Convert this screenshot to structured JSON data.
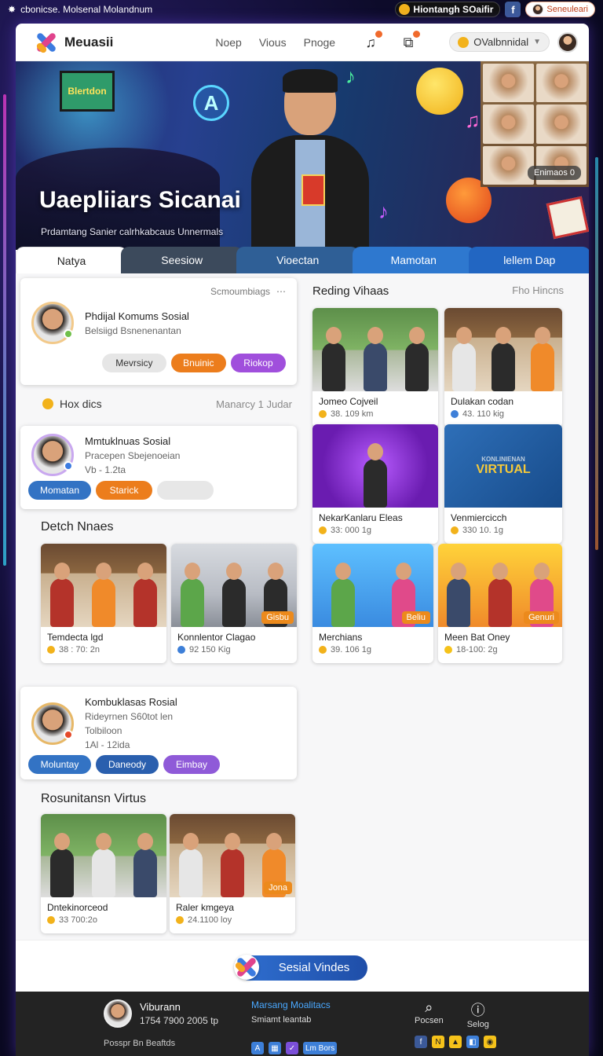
{
  "topbar": {
    "brand_text": "cbonicse. Molsenal Molandnum",
    "coin_pill": "Hiontangh SOaifir",
    "fb_letter": "f",
    "right_pill": "Seneuleari"
  },
  "nav": {
    "logo_text": "Meuasii",
    "links": [
      "Noep",
      "Vious",
      "Pnoge"
    ],
    "account_label": "OValbnnidal",
    "icons": [
      "music-icon",
      "box-icon"
    ]
  },
  "hero": {
    "screen_text": "Blertdon",
    "badge": "Enimaos 0",
    "title": "Uaepliiars Sicanai",
    "subtitle": "Prdamtang Sanier calrhkabcaus Unnermals"
  },
  "tabs": [
    "Natya",
    "Seesiow",
    "Vioectan",
    "Mamotan",
    "lellem Dap"
  ],
  "left": {
    "card1": {
      "header": "Scmoumbiags",
      "name": "Phdijal Komums Sosial",
      "line1": "Belsiigd Bsnenenantan",
      "buttons": [
        "Mevrsicy",
        "Bnuinic",
        "Riokop"
      ]
    },
    "row1": {
      "label": "Hox dics",
      "right": "Manarcy 1 Judar"
    },
    "card2": {
      "name": "Mmtuklnuas Sosial",
      "line1": "Pracepen Sbejenoeian",
      "line2": "Vb - 1.2ta",
      "buttons": [
        "Momatan",
        "Starick",
        ""
      ]
    },
    "section1": "Detch Nnaes",
    "media1": [
      {
        "caption": "Temdecta lgd",
        "meta": "38 : 70: 2n",
        "badge": ""
      },
      {
        "caption": "Konnlentor Clagao",
        "meta": "92 150 Kig",
        "badge": "Gisbu"
      }
    ],
    "card3": {
      "name": "Kombuklasas Rosial",
      "line1": "Rideyrnen S60tot len",
      "line2": "Tolbiloon",
      "line3": "1Al - 12ida",
      "buttons": [
        "Moluntay",
        "Daneody",
        "Eimbay"
      ]
    },
    "section2": "Rosunitansn Virtus",
    "media2": [
      {
        "caption": "Dntekinorceod",
        "meta": "33 700:2o",
        "badge": ""
      },
      {
        "caption": "Raler kmgeya",
        "meta": "24.1100 loy",
        "badge": "Jona"
      }
    ]
  },
  "right": {
    "title": "Reding Vihaas",
    "muted": "Fho Hincns",
    "tiles": [
      {
        "caption": "Jomeo Cojveil",
        "meta": "38. 109 km",
        "badge": ""
      },
      {
        "caption": "Dulakan codan",
        "meta": "43. 110 kig",
        "badge": ""
      },
      {
        "caption": "NekarKanlaru Eleas",
        "meta": "33: 000 1g",
        "badge": ""
      },
      {
        "caption": "Venmiercicch",
        "meta": "330 10. 1g",
        "badge": ""
      },
      {
        "caption": "Merchians",
        "meta": "39. 106 1g",
        "badge": "Beliu"
      },
      {
        "caption": "Meen Bat Oney",
        "meta": "18-100: 2g",
        "badge": "Genuri"
      }
    ],
    "virtual_small": "KONLINIENAN",
    "virtual_big": "VIRTUAL"
  },
  "cta": {
    "label": "Sesial Vindes"
  },
  "footer": {
    "name": "Viburann",
    "phone": "1754 7900 2005 tp",
    "small": "Posspr Bn Beaftds",
    "mid_heading": "Marsang Moalitacs",
    "mid_sub": "Smiamt leantab",
    "mid_pill": "Lm Bors",
    "right_items": [
      {
        "icon": "search-icon",
        "label": "Pocsen"
      },
      {
        "icon": "info-icon",
        "label": "Selog"
      }
    ]
  },
  "colors": {
    "accent_orange": "#ec7d1c",
    "accent_purple": "#a04fdc",
    "accent_blue": "#3373c4",
    "tab_dark": "#3c4a5c"
  }
}
